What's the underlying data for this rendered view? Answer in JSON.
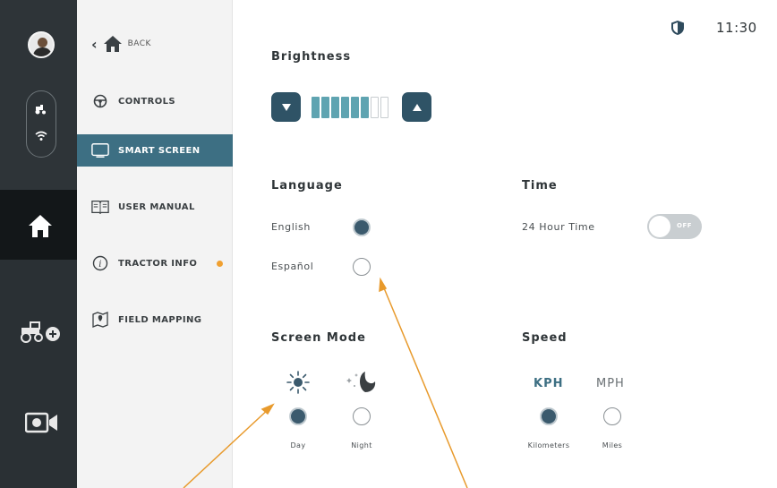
{
  "clock": "11:30",
  "menu": {
    "back_label": "BACK",
    "items": [
      {
        "label": "CONTROLS"
      },
      {
        "label": "SMART SCREEN"
      },
      {
        "label": "USER MANUAL"
      },
      {
        "label": "TRACTOR INFO"
      },
      {
        "label": "FIELD MAPPING"
      }
    ]
  },
  "brightness": {
    "title": "Brightness",
    "level": 6,
    "max": 8
  },
  "language": {
    "title": "Language",
    "options": [
      {
        "label": "English",
        "selected": true
      },
      {
        "label": "Español",
        "selected": false
      }
    ]
  },
  "time": {
    "title": "Time",
    "option_label": "24 Hour Time",
    "toggle_text": "OFF",
    "enabled": false
  },
  "screen_mode": {
    "title": "Screen Mode",
    "options": [
      {
        "label": "Day",
        "icon": "sun-icon",
        "selected": true
      },
      {
        "label": "Night",
        "icon": "moon-icon",
        "selected": false
      }
    ]
  },
  "speed": {
    "title": "Speed",
    "options": [
      {
        "unit": "KPH",
        "label": "Kilometers",
        "selected": true
      },
      {
        "unit": "MPH",
        "label": "Miles",
        "selected": false
      }
    ]
  },
  "colors": {
    "accent": "#3d6f83",
    "rail": "#2a3034",
    "segment_on": "#5fa4b1",
    "notification": "#f0a030",
    "annotation_arrow": "#e89a2c"
  }
}
